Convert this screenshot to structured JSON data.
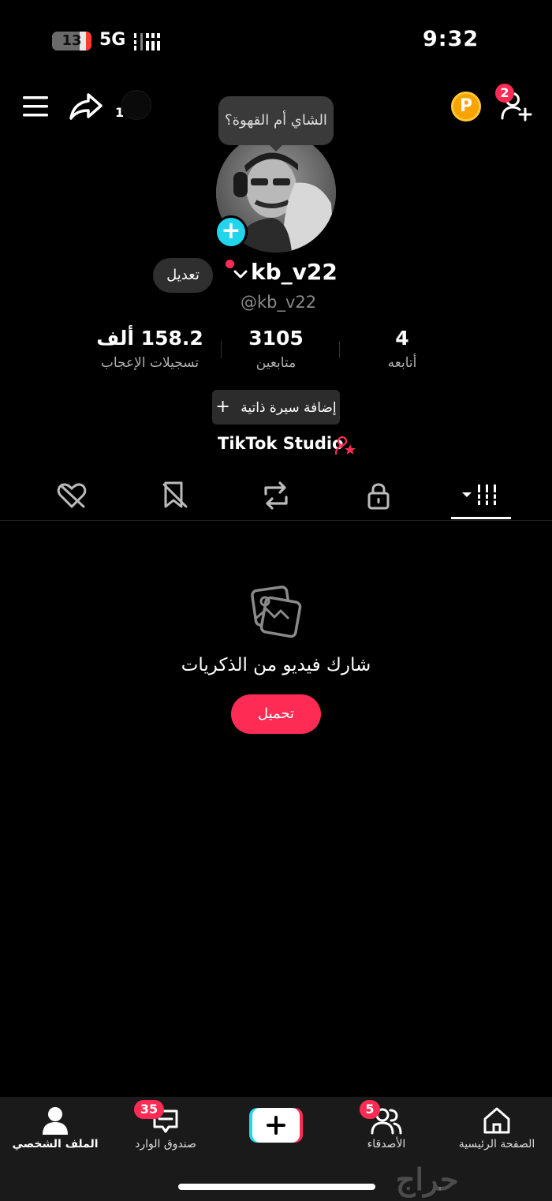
{
  "status_bar": {
    "battery": 13,
    "network": "5G",
    "time": "9:32"
  },
  "top_bar": {
    "share_count": "1",
    "coin_label": "P",
    "friend_requests": "2",
    "tooltip": "الشاي أم القهوة؟"
  },
  "profile": {
    "edit_label": "تعديل",
    "display_name": "kb_v22",
    "handle": "@kb_v22",
    "stats": {
      "likes": {
        "value": "158.2 ألف",
        "label": "تسجيلات الإعجاب"
      },
      "followers": {
        "value": "3105",
        "label": "متابعين"
      },
      "following": {
        "value": "4",
        "label": "أتابعه"
      }
    },
    "bio_button": "إضافة سيرة ذاتية",
    "studio": "TikTok Studio"
  },
  "tabs": [
    {
      "icon": "liked-hidden-icon"
    },
    {
      "icon": "favorites-hidden-icon"
    },
    {
      "icon": "repost-icon"
    },
    {
      "icon": "lock-icon"
    },
    {
      "icon": "videos-grid-icon",
      "active": true
    }
  ],
  "empty_state": {
    "title": "شارك فيديو من الذكريات",
    "button": "تحميل"
  },
  "bottom_nav": {
    "profile": "الملف الشخصي",
    "inbox": "صندوق الوارد",
    "inbox_badge": "35",
    "friends": "الأصدقاء",
    "friends_badge": "5",
    "home": "الصفحة الرئيسية"
  },
  "watermark": "حراج",
  "colors": {
    "accent": "#fe2c55",
    "cyan": "#20d5ec",
    "coin": "#f7a400"
  }
}
